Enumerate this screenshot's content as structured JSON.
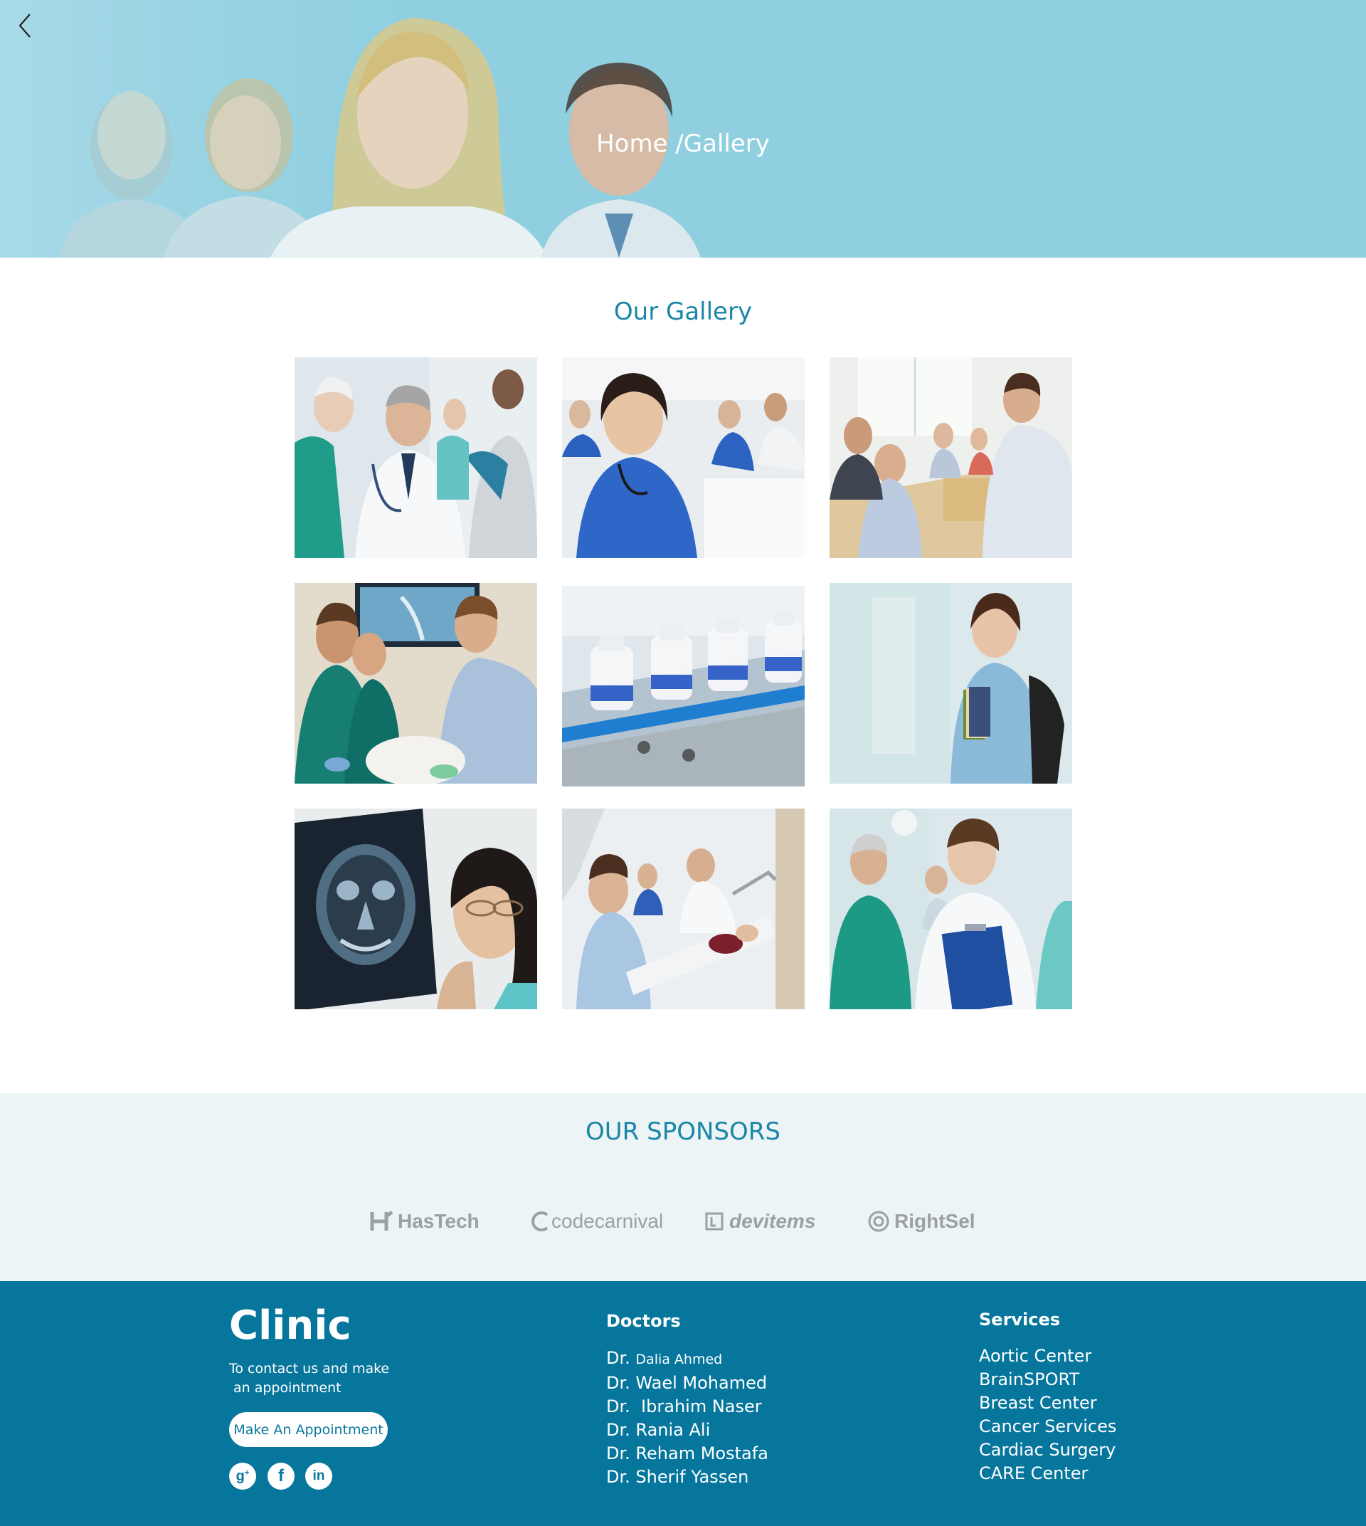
{
  "hero": {
    "breadcrumb": "Home /Gallery",
    "back_icon": "chevron-left-icon"
  },
  "gallery": {
    "title": "Our Gallery",
    "images": [
      "doctors-handshake-photo",
      "smiling-nurse-meeting-photo",
      "team-conference-photo",
      "surgeons-training-photo",
      "medicine-vials-production-photo",
      "student-nurse-with-books-photo",
      "doctor-viewing-xray-photo",
      "emergency-stretcher-photo",
      "doctor-with-clipboard-photo"
    ]
  },
  "sponsors": {
    "title": "OUR SPONSORS",
    "logos": [
      "HasTech",
      "codecarnival",
      "devitems",
      "RightSel"
    ]
  },
  "footer": {
    "brand": "Clinic",
    "contact_line_1": "To contact us and make",
    "contact_line_2": "an appointment",
    "appointment_button": "Make An Appointment",
    "social": [
      "google-plus-icon",
      "facebook-icon",
      "linkedin-icon"
    ],
    "doctors_heading": "Doctors",
    "doctors": [
      {
        "prefix": "Dr.",
        "name": "Dalia Ahmed"
      },
      {
        "prefix": "Dr.",
        "name": "Wael Mohamed"
      },
      {
        "prefix": "Dr.",
        "name": " Ibrahim Naser"
      },
      {
        "prefix": "Dr.",
        "name": "Rania Ali"
      },
      {
        "prefix": "Dr.",
        "name": "Reham Mostafa"
      },
      {
        "prefix": "Dr.",
        "name": "Sherif Yassen"
      }
    ],
    "services_heading": "Services",
    "services": [
      "Aortic Center",
      "BrainSPORT",
      "Breast Center",
      "Cancer Services",
      "Cardiac Surgery",
      "CARE Center"
    ]
  },
  "colors": {
    "hero_bg": "#8fcfe0",
    "accent": "#1a86a8",
    "footer_bg": "#07769d",
    "sponsors_bg": "#edf4f6"
  }
}
